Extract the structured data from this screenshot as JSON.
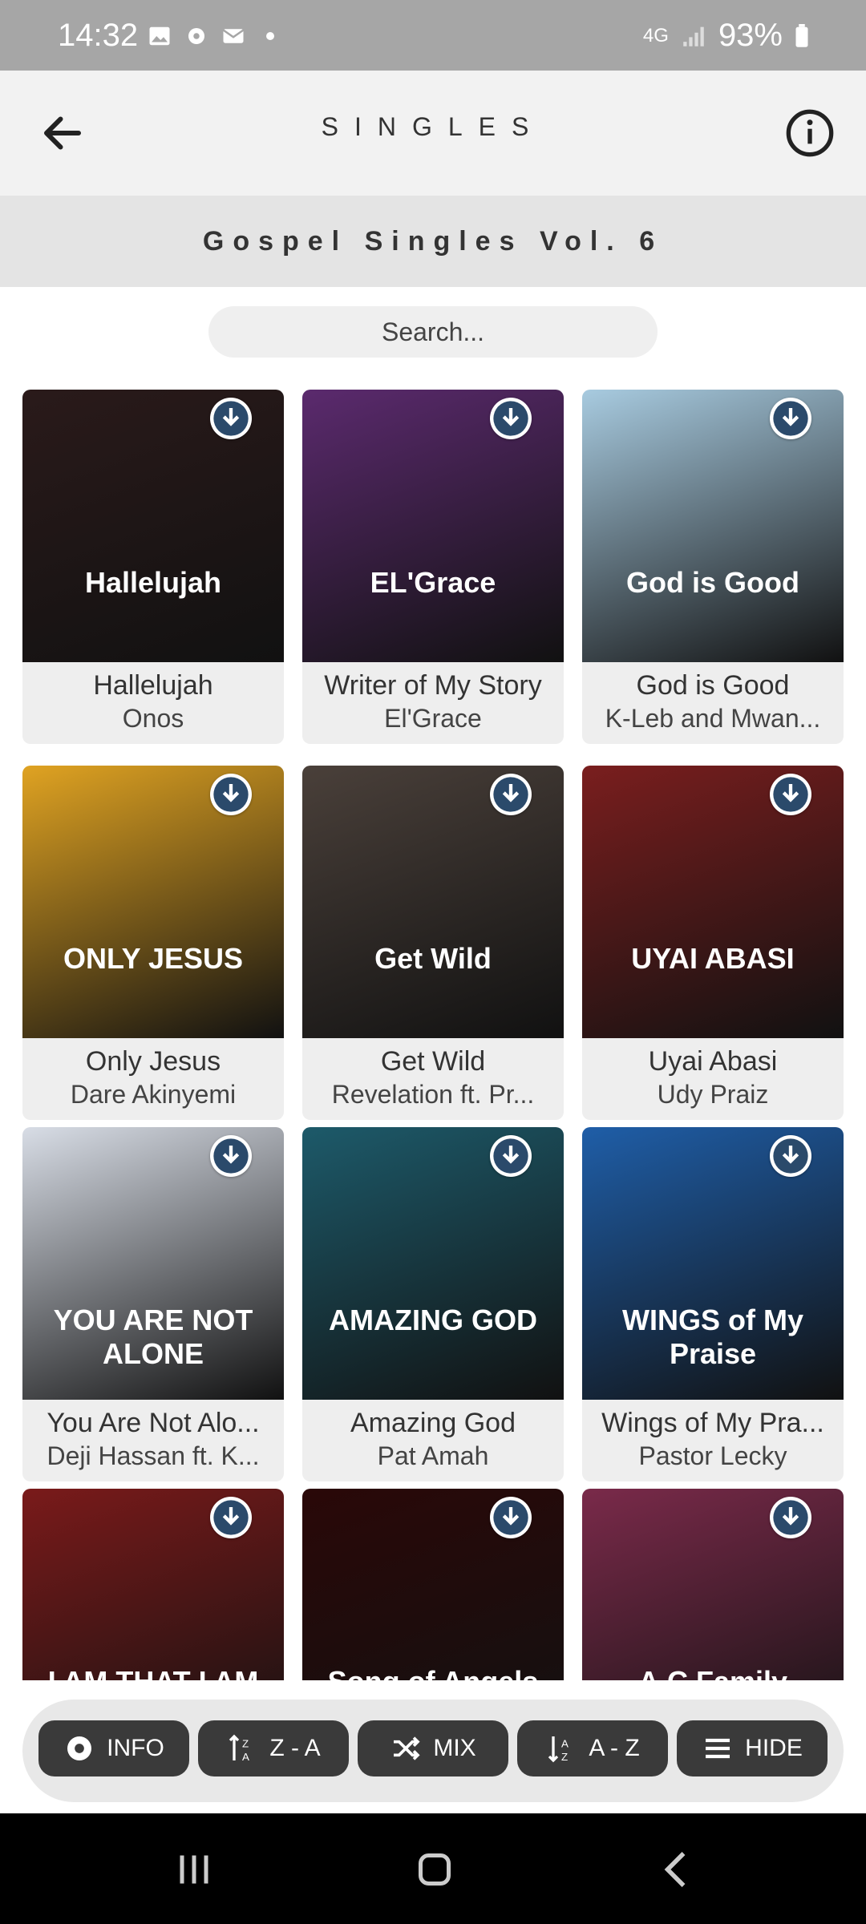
{
  "status_bar": {
    "time": "14:32",
    "battery": "93%",
    "network": "4G"
  },
  "header": {
    "title": "SINGLES",
    "subtitle": "Gospel Singles Vol. 6"
  },
  "search": {
    "placeholder": "Search..."
  },
  "songs": [
    {
      "title": "Hallelujah",
      "artist": "Onos",
      "cover_text": "Hallelujah",
      "cover_color": "#2a1a1a"
    },
    {
      "title": "Writer of My Story",
      "artist": "El'Grace",
      "cover_text": "EL'Grace",
      "cover_color": "#5b2a6e"
    },
    {
      "title": "God is Good",
      "artist": "K-Leb and Mwan...",
      "cover_text": "God is Good",
      "cover_color": "#a8cbe0"
    },
    {
      "title": "Only Jesus",
      "artist": "Dare Akinyemi",
      "cover_text": "ONLY JESUS",
      "cover_color": "#e0a322"
    },
    {
      "title": "Get Wild",
      "artist": "Revelation ft. Pr...",
      "cover_text": "Get Wild",
      "cover_color": "#4a403a"
    },
    {
      "title": "Uyai Abasi",
      "artist": "Udy Praiz",
      "cover_text": "UYAI ABASI",
      "cover_color": "#7a1e1e"
    },
    {
      "title": "You Are Not Alo...",
      "artist": "Deji Hassan ft. K...",
      "cover_text": "YOU ARE NOT ALONE",
      "cover_color": "#d8dde6"
    },
    {
      "title": "Amazing God",
      "artist": "Pat Amah",
      "cover_text": "AMAZING GOD",
      "cover_color": "#1d5a6a"
    },
    {
      "title": "Wings of My Pra...",
      "artist": "Pastor Lecky",
      "cover_text": "WINGS of My Praise",
      "cover_color": "#1f5ea8"
    },
    {
      "title": "",
      "artist": "",
      "cover_text": "I AM THAT I AM",
      "cover_color": "#7a1a1a"
    },
    {
      "title": "",
      "artist": "",
      "cover_text": "Song of Angels",
      "cover_color": "#2a0808"
    },
    {
      "title": "",
      "artist": "",
      "cover_text": "A.C Family",
      "cover_color": "#7a2a4a"
    }
  ],
  "toolbar": {
    "info": "INFO",
    "za": "Z - A",
    "mix": "MIX",
    "az": "A - Z",
    "hide": "HIDE"
  },
  "icons": [
    "back-arrow-icon",
    "info-circle-icon",
    "download-icon",
    "gear-icon",
    "sort-desc-icon",
    "shuffle-icon",
    "sort-asc-icon",
    "menu-icon"
  ]
}
